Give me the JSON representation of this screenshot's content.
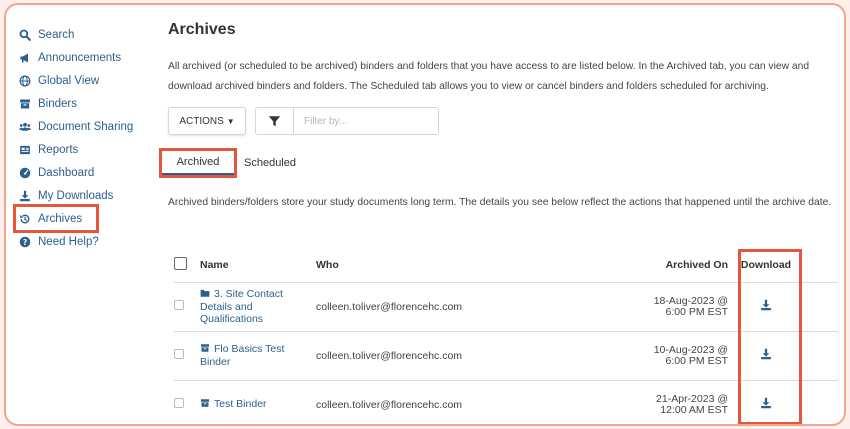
{
  "sidebar": {
    "items": [
      {
        "label": "Search",
        "icon": "search-icon"
      },
      {
        "label": "Announcements",
        "icon": "megaphone-icon"
      },
      {
        "label": "Global View",
        "icon": "globe-icon"
      },
      {
        "label": "Binders",
        "icon": "archive-box-icon"
      },
      {
        "label": "Document Sharing",
        "icon": "users-icon"
      },
      {
        "label": "Reports",
        "icon": "report-icon"
      },
      {
        "label": "Dashboard",
        "icon": "dashboard-icon"
      },
      {
        "label": "My Downloads",
        "icon": "download-icon"
      },
      {
        "label": "Archives",
        "icon": "history-icon"
      },
      {
        "label": "Need Help?",
        "icon": "question-icon"
      }
    ]
  },
  "main": {
    "title": "Archives",
    "intro": "All archived (or scheduled to be archived) binders and folders that you have access to are listed below. In the Archived tab, you can view and download archived binders and folders. The Scheduled tab allows you to view or cancel binders and folders scheduled for archiving.",
    "actions_label": "ACTIONS",
    "filter_placeholder": "Filter by...",
    "tabs": [
      "Archived",
      "Scheduled"
    ],
    "description": "Archived binders/folders store your study documents long term. The details you see below reflect the actions that happened until the archive date.",
    "table": {
      "headers": {
        "name": "Name",
        "who": "Who",
        "archived_on": "Archived On",
        "download": "Download"
      },
      "rows": [
        {
          "type": "folder",
          "name": "3. Site Contact Details and Qualifications",
          "who": "colleen.toliver@florencehc.com",
          "date": "18-Aug-2023 @",
          "time": "6:00 PM EST"
        },
        {
          "type": "binder",
          "name": "Flo Basics Test Binder",
          "who": "colleen.toliver@florencehc.com",
          "date": "10-Aug-2023 @",
          "time": "6:00 PM EST"
        },
        {
          "type": "binder",
          "name": "Test Binder",
          "who": "colleen.toliver@florencehc.com",
          "date": "21-Apr-2023 @",
          "time": "12:00 AM EST"
        }
      ]
    }
  },
  "colors": {
    "link": "#2b5f8c",
    "highlight": "#e4573d",
    "frame": "#f1a58c"
  }
}
